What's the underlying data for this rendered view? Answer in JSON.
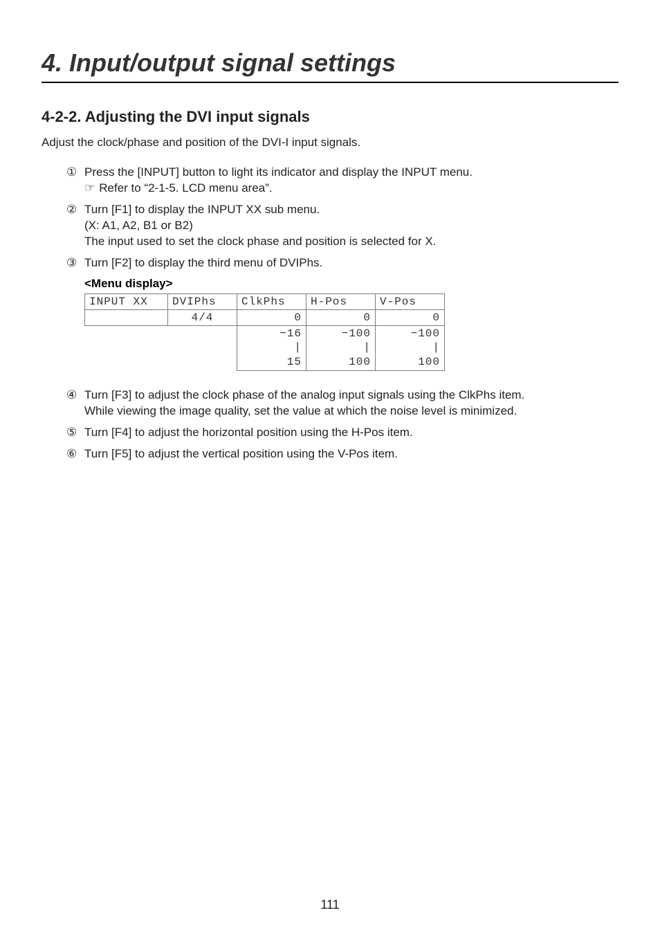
{
  "chapter_title": "4. Input/output signal settings",
  "section_title": "4-2-2. Adjusting the DVI input signals",
  "intro": "Adjust the clock/phase and position of the DVI-I input signals.",
  "steps": {
    "s1": {
      "num": "①",
      "text": "Press the [INPUT] button to light its indicator and display the INPUT menu.",
      "ref_icon": "☞",
      "ref_text": "Refer to “2-1-5. LCD menu area”."
    },
    "s2": {
      "num": "②",
      "line1": "Turn [F1] to display the INPUT XX sub menu.",
      "line2": "(X: A1, A2, B1 or B2)",
      "line3": "The input used to set the clock phase and position is selected for X."
    },
    "s3": {
      "num": "③",
      "text": "Turn [F2] to display the third menu of DVIPhs."
    },
    "s4": {
      "num": "④",
      "line1": "Turn [F3] to adjust the clock phase of the analog input signals using the ClkPhs item.",
      "line2": "While viewing the image quality, set the value at which the noise level is minimized."
    },
    "s5": {
      "num": "⑤",
      "text": "Turn [F4] to adjust the horizontal position using the H-Pos item."
    },
    "s6": {
      "num": "⑥",
      "text": "Turn [F5] to adjust the vertical position using the V-Pos item."
    }
  },
  "menu_display_label": "<Menu display>",
  "menu": {
    "headers": {
      "c0": "INPUT XX",
      "c1": "DVIPhs",
      "c2": "ClkPhs",
      "c3": "H-Pos",
      "c4": "V-Pos"
    },
    "values": {
      "c0": "",
      "c1": "4/4",
      "c2": "0",
      "c3": "0",
      "c4": "0"
    },
    "range": {
      "c2": "−16\n|\n15",
      "c3": "−100\n|\n100",
      "c4": "−100\n|\n100"
    }
  },
  "page_number": "111"
}
